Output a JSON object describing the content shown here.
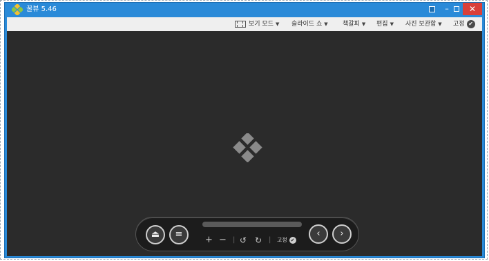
{
  "window": {
    "title": "꿀뷰 5.46",
    "controls": {
      "pin": "",
      "minimize": "–",
      "maximize": "",
      "close": "✕"
    }
  },
  "toolbar": {
    "view_mode": "보기 모드",
    "slideshow": "슬라이드 쇼",
    "bookmark": "책갈피",
    "edit": "편집",
    "photo_album": "사진 보관함",
    "fix": "고정",
    "dropdown_arrow": "▼",
    "check": "✔"
  },
  "controls": {
    "eject": "⏏",
    "list": "≡",
    "zoom_in": "+",
    "zoom_out": "−",
    "separator": "|",
    "rotate_left": "↺",
    "rotate_right": "↻",
    "fix": "고정",
    "fix_check": "✔",
    "prev": "‹",
    "next": "›"
  },
  "colors": {
    "title_bar": "#2a8ad8",
    "close_button": "#d9403a",
    "canvas": "#2b2b2b",
    "toolbar": "#efefef"
  },
  "icons": [
    "app-logo-icon",
    "view-mode-icon",
    "check-icon",
    "eject-icon",
    "list-icon",
    "zoom-in-icon",
    "zoom-out-icon",
    "rotate-left-icon",
    "rotate-right-icon",
    "chevron-left-icon",
    "chevron-right-icon",
    "center-logo-icon"
  ]
}
